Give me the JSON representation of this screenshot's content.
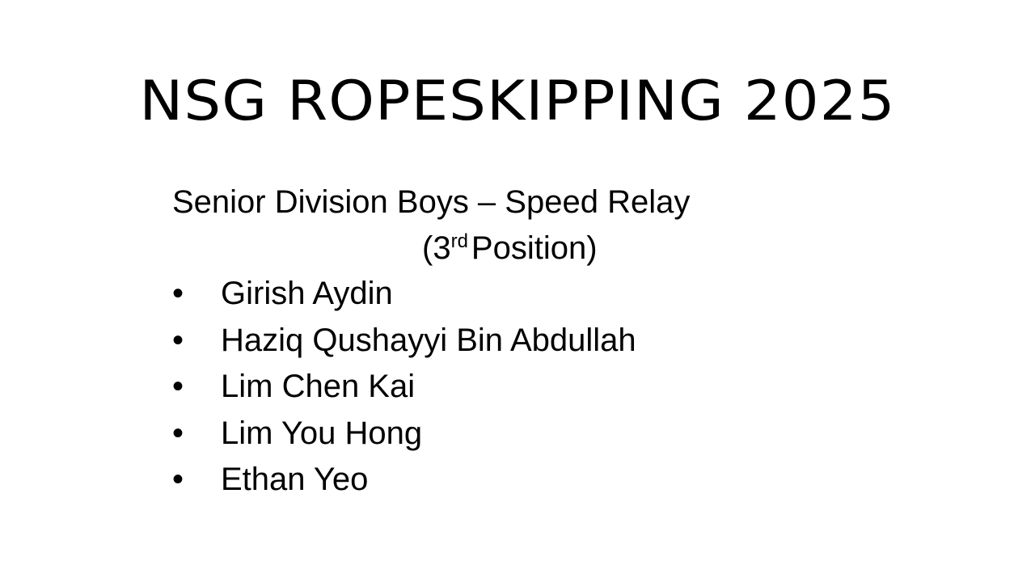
{
  "slide": {
    "title": "NSG ROPESKIPPING 2025",
    "subtitle": "Senior Division Boys – Speed Relay",
    "position": {
      "open": "(3",
      "ordinal_suffix": "rd",
      "close": "Position)"
    },
    "bullet_glyph": "•",
    "members": [
      {
        "name": "Girish Aydin"
      },
      {
        "name": "Haziq Qushayyi Bin Abdullah"
      },
      {
        "name": "Lim Chen Kai"
      },
      {
        "name": "Lim You Hong"
      },
      {
        "name": "Ethan Yeo"
      }
    ]
  }
}
